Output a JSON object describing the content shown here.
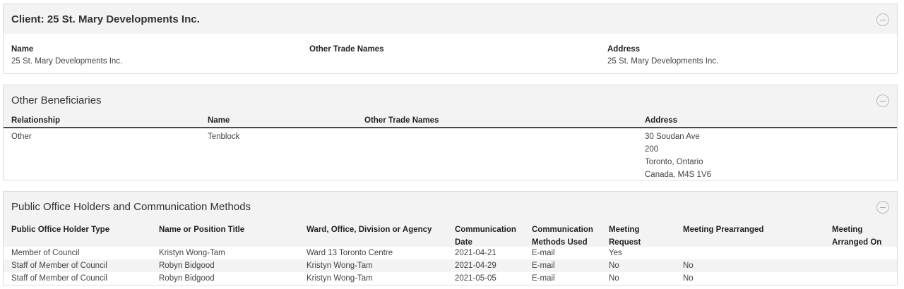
{
  "client": {
    "title": "Client: 25 St. Mary Developments Inc.",
    "name_label": "Name",
    "name_value": "25 St. Mary Developments Inc.",
    "trade_label": "Other Trade Names",
    "trade_value": "",
    "address_label": "Address",
    "address_value": "25 St. Mary Developments Inc."
  },
  "beneficiaries": {
    "title": "Other Beneficiaries",
    "columns": [
      "Relationship",
      "Name",
      "Other Trade Names",
      "Address"
    ],
    "rows": [
      {
        "relationship": "Other",
        "name": "Tenblock",
        "trade": "",
        "address": [
          "30 Soudan Ave",
          "200",
          "Toronto, Ontario",
          "Canada, M4S 1V6"
        ]
      }
    ]
  },
  "poh": {
    "title": "Public Office Holders and Communication Methods",
    "columns": [
      [
        "Public Office Holder Type"
      ],
      [
        "Name or Position Title"
      ],
      [
        "Ward, Office, Division or Agency"
      ],
      [
        "Communication",
        "Date"
      ],
      [
        "Communication",
        "Methods Used"
      ],
      [
        "Meeting",
        "Request"
      ],
      [
        "Meeting Prearranged"
      ],
      [
        "Meeting",
        "Arranged On"
      ]
    ],
    "rows": [
      [
        "Member of Council",
        "Kristyn Wong-Tam",
        "Ward 13 Toronto Centre",
        "2021-04-21",
        "E-mail",
        "Yes",
        "",
        ""
      ],
      [
        "Staff of Member of Council",
        "Robyn Bidgood",
        "Kristyn Wong-Tam",
        "2021-04-29",
        "E-mail",
        "No",
        "No",
        ""
      ],
      [
        "Staff of Member of Council",
        "Robyn Bidgood",
        "Kristyn Wong-Tam",
        "2021-05-05",
        "E-mail",
        "No",
        "No",
        ""
      ]
    ]
  }
}
